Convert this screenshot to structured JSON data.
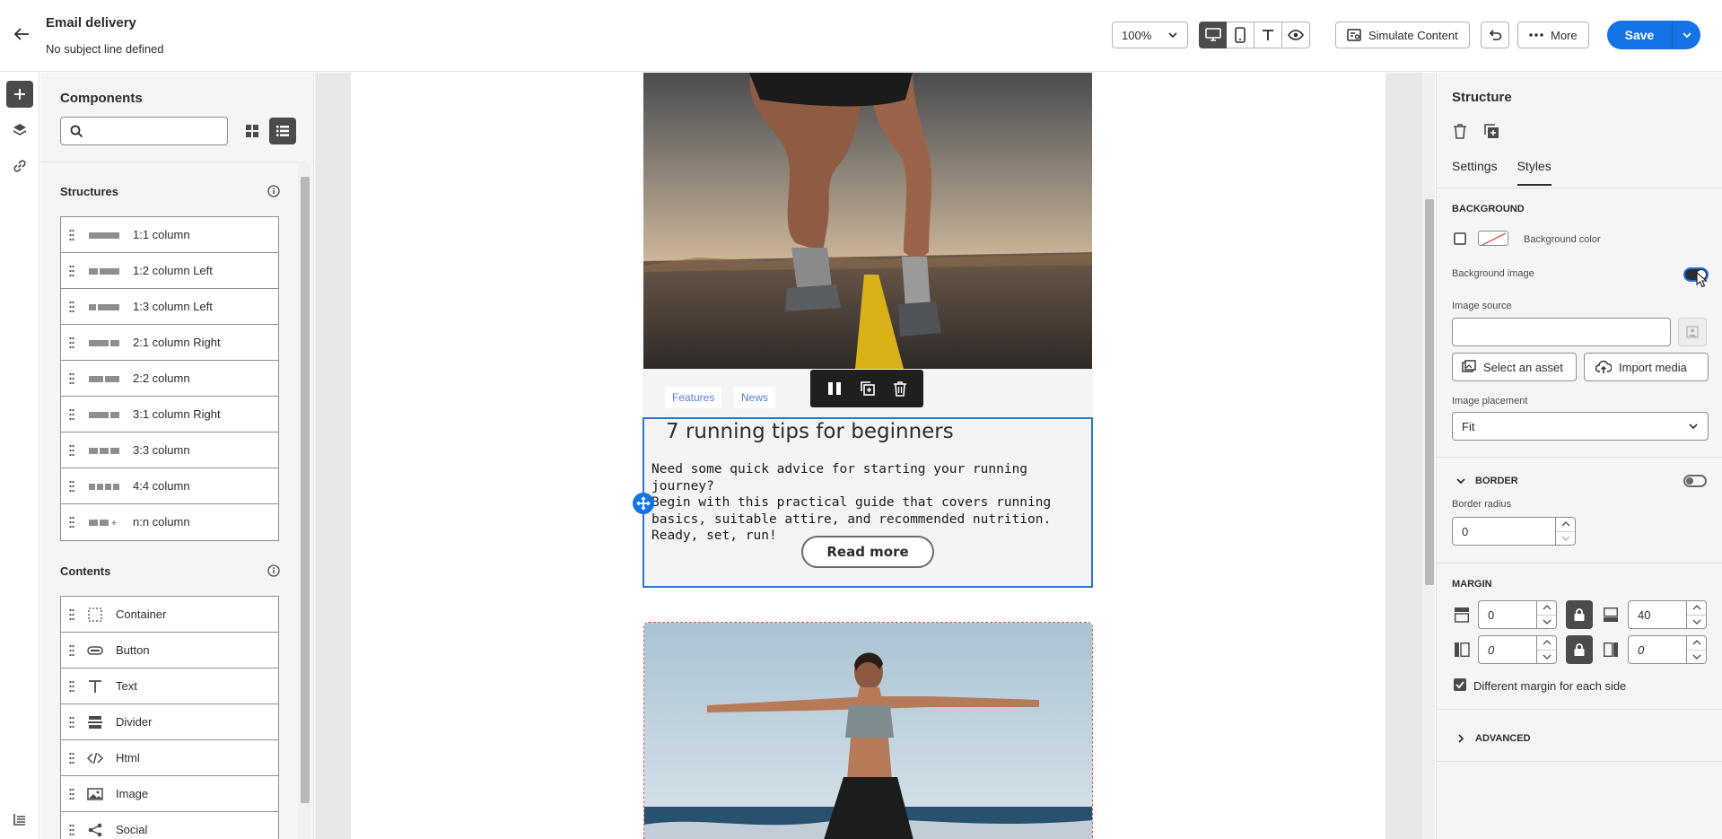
{
  "header": {
    "title": "Email delivery",
    "subtitle": "No subject line defined",
    "zoom": "100%",
    "simulate_label": "Simulate Content",
    "more_label": "More",
    "save_label": "Save"
  },
  "components": {
    "title": "Components",
    "search_placeholder": "",
    "structures_heading": "Structures",
    "structures": [
      {
        "label": "1:1 column",
        "icon": "col-1-1"
      },
      {
        "label": "1:2 column Left",
        "icon": "col-1-2"
      },
      {
        "label": "1:3 column Left",
        "icon": "col-1-3"
      },
      {
        "label": "2:1 column Right",
        "icon": "col-2-1"
      },
      {
        "label": "2:2 column",
        "icon": "col-2-2"
      },
      {
        "label": "3:1 column Right",
        "icon": "col-3-1"
      },
      {
        "label": "3:3 column",
        "icon": "col-3-3"
      },
      {
        "label": "4:4 column",
        "icon": "col-4-4"
      },
      {
        "label": "n:n column",
        "icon": "col-n-n"
      }
    ],
    "contents_heading": "Contents",
    "contents": [
      {
        "label": "Container",
        "icon": "container-icon"
      },
      {
        "label": "Button",
        "icon": "button-icon"
      },
      {
        "label": "Text",
        "icon": "text-icon"
      },
      {
        "label": "Divider",
        "icon": "divider-icon"
      },
      {
        "label": "Html",
        "icon": "code-icon"
      },
      {
        "label": "Image",
        "icon": "image-icon"
      },
      {
        "label": "Social",
        "icon": "share-icon"
      }
    ]
  },
  "canvas": {
    "tags": [
      "Features",
      "News"
    ],
    "article_title": "7 running tips for beginners",
    "article_body": "Need some quick advice for starting your running journey?\nBegin with this practical guide that covers running basics, suitable attire, and recommended nutrition.\nReady, set, run!",
    "cta_label": "Read more"
  },
  "properties": {
    "title": "Structure",
    "tabs": [
      "Settings",
      "Styles"
    ],
    "active_tab": "Styles",
    "background_heading": "BACKGROUND",
    "background_color_label": "Background color",
    "background_image_label": "Background image",
    "background_image_enabled": true,
    "image_source_label": "Image source",
    "image_source_value": "",
    "select_asset_label": "Select an asset",
    "import_media_label": "Import media",
    "image_placement_label": "Image placement",
    "image_placement_value": "Fit",
    "border_heading": "BORDER",
    "border_enabled": false,
    "border_radius_label": "Border radius",
    "border_radius_value": "0",
    "margin_heading": "MARGIN",
    "margin_top": "0",
    "margin_bottom": "40",
    "margin_left": "0",
    "margin_right": "0",
    "different_margin_label": "Different margin for each side",
    "different_margin_checked": true,
    "advanced_heading": "ADVANCED"
  },
  "colors": {
    "accent": "#1473e6",
    "selection": "#2a74d8",
    "dark_button": "#4b4b4b"
  }
}
